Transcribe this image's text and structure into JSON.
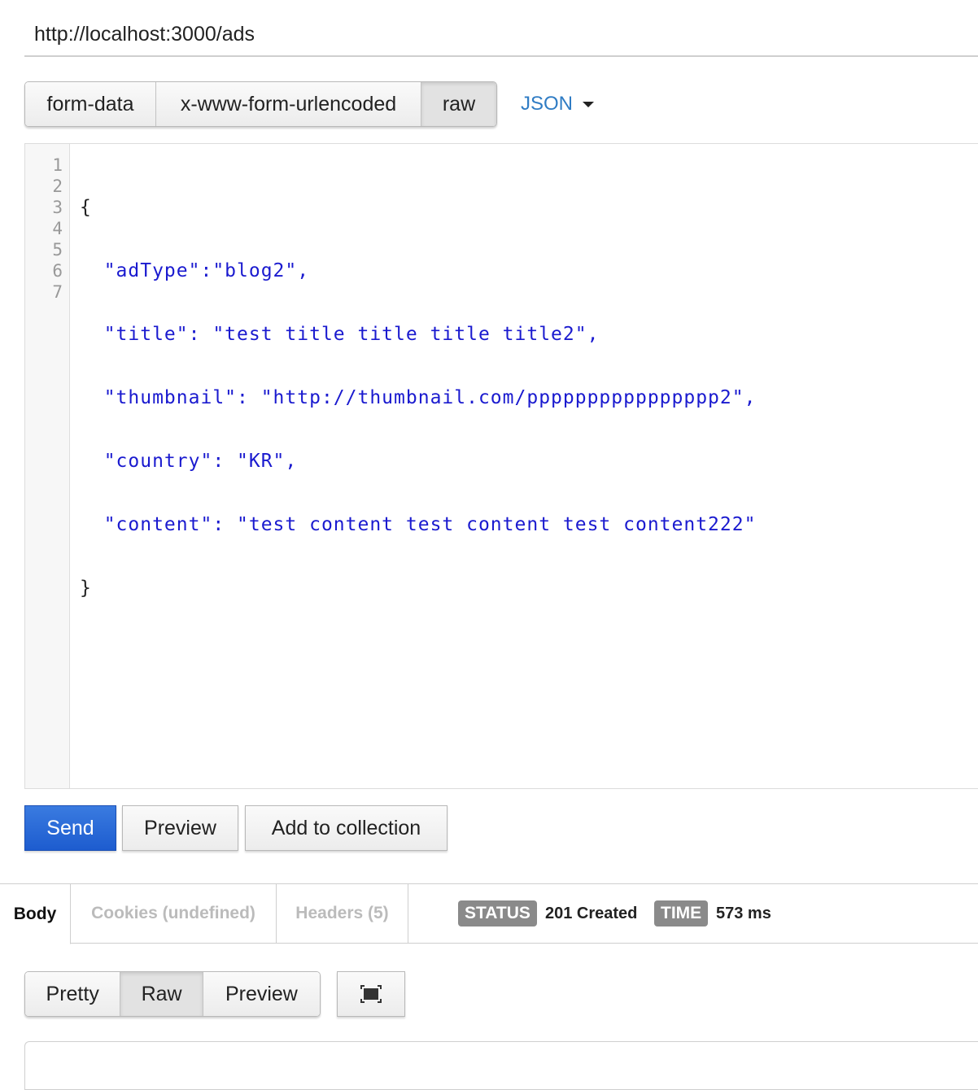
{
  "request": {
    "url": "http://localhost:3000/ads"
  },
  "body_types": [
    "form-data",
    "x-www-form-urlencoded",
    "raw"
  ],
  "active_body_type": "raw",
  "format_dropdown": {
    "selected": "JSON"
  },
  "editor": {
    "line_numbers": [
      "1",
      "2",
      "3",
      "4",
      "5",
      "6",
      "7"
    ],
    "lines": [
      "{",
      "  \"adType\":\"blog2\",",
      "  \"title\": \"test title title title title2\",",
      "  \"thumbnail\": \"http://thumbnail.com/pppppppppppppppp2\",",
      "  \"country\": \"KR\",",
      "  \"content\": \"test content test content test content222\"",
      "}"
    ]
  },
  "actions": {
    "send_label": "Send",
    "preview_label": "Preview",
    "collection_label": "Add to collection"
  },
  "response": {
    "tabs": {
      "body": "Body",
      "cookies": "Cookies (undefined)",
      "headers": "Headers (5)"
    },
    "status_label": "STATUS",
    "status_value": "201 Created",
    "time_label": "TIME",
    "time_value": "573 ms",
    "view_modes": [
      "Pretty",
      "Raw",
      "Preview"
    ],
    "active_view_mode": "Raw"
  },
  "colors": {
    "send_button": "#1d5ccf",
    "json_link": "#2f7cc4",
    "code_string": "#1a1acf",
    "badge": "#8a8a8a"
  },
  "icons": {
    "format_caret": "caret-down-icon",
    "expand": "fullscreen-icon"
  }
}
